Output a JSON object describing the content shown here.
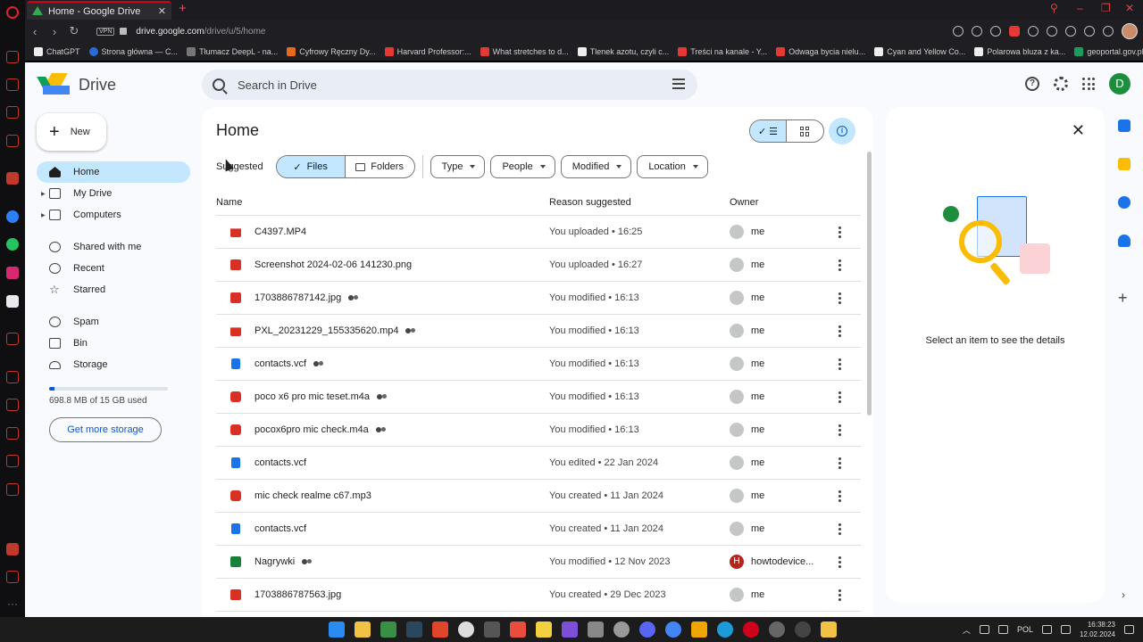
{
  "browser": {
    "tab_title": "Home - Google Drive",
    "new_tab": "+",
    "url_host": "drive.google.com",
    "url_path": "/drive/u/5/home",
    "vpn_label": "VPN",
    "bookmarks": [
      {
        "label": "ChatGPT",
        "icon": "chatgpt-icon"
      },
      {
        "label": "Strona główna — C...",
        "icon": "globe-icon"
      },
      {
        "label": "Tłumacz DeepL - na...",
        "icon": "deepl-icon"
      },
      {
        "label": "Cyfrowy Ręczny Dy...",
        "icon": "allegro-icon"
      },
      {
        "label": "Harvard Professor:...",
        "icon": "youtube-icon"
      },
      {
        "label": "What stretches to d...",
        "icon": "youtube-icon"
      },
      {
        "label": "Tlenek azotu, czyli c...",
        "icon": "site-icon"
      },
      {
        "label": "Treści na kanale - Y...",
        "icon": "youtube-icon"
      },
      {
        "label": "Odwaga bycia nielu...",
        "icon": "youtube-icon"
      },
      {
        "label": "Cyan and Yellow Co...",
        "icon": "doc-icon"
      },
      {
        "label": "Polarowa bluza z ka...",
        "icon": "site-icon"
      },
      {
        "label": "geoportal.gov.pl",
        "icon": "geoportal-icon"
      }
    ]
  },
  "drive": {
    "app_name": "Drive",
    "search_placeholder": "Search in Drive",
    "user_initial": "D",
    "new_label": "New",
    "nav": [
      {
        "label": "Home",
        "icon": "home-icon",
        "active": true
      },
      {
        "label": "My Drive",
        "icon": "my-drive-icon"
      },
      {
        "label": "Computers",
        "icon": "computer-icon"
      },
      {
        "label": "Shared with me",
        "icon": "shared-icon"
      },
      {
        "label": "Recent",
        "icon": "clock-icon"
      },
      {
        "label": "Starred",
        "icon": "star-icon"
      },
      {
        "label": "Spam",
        "icon": "spam-icon"
      },
      {
        "label": "Bin",
        "icon": "bin-icon"
      },
      {
        "label": "Storage",
        "icon": "cloud-icon"
      }
    ],
    "storage_text": "698.8 MB of 15 GB used",
    "storage_fraction": 0.047,
    "get_more_storage": "Get more storage",
    "page_title": "Home",
    "suggested_label": "Suggested",
    "files_label": "Files",
    "folders_label": "Folders",
    "filter_chips": [
      "Type",
      "People",
      "Modified",
      "Location"
    ],
    "columns": {
      "name": "Name",
      "reason": "Reason suggested",
      "owner": "Owner"
    },
    "files": [
      {
        "name": "C4397.MP4",
        "type": "video",
        "shared": false,
        "reason": "You uploaded • 16:25",
        "owner": "me",
        "owner_initial": ""
      },
      {
        "name": "Screenshot 2024-02-06 141230.png",
        "type": "image",
        "shared": false,
        "reason": "You uploaded • 16:27",
        "owner": "me",
        "owner_initial": ""
      },
      {
        "name": "1703886787142.jpg",
        "type": "image",
        "shared": true,
        "reason": "You modified • 16:13",
        "owner": "me",
        "owner_initial": ""
      },
      {
        "name": "PXL_20231229_155335620.mp4",
        "type": "video",
        "shared": true,
        "reason": "You modified • 16:13",
        "owner": "me",
        "owner_initial": ""
      },
      {
        "name": "contacts.vcf",
        "type": "doc",
        "shared": true,
        "reason": "You modified • 16:13",
        "owner": "me",
        "owner_initial": ""
      },
      {
        "name": "poco x6 pro mic teset.m4a",
        "type": "audio",
        "shared": true,
        "reason": "You modified • 16:13",
        "owner": "me",
        "owner_initial": ""
      },
      {
        "name": "pocox6pro mic check.m4a",
        "type": "audio",
        "shared": true,
        "reason": "You modified • 16:13",
        "owner": "me",
        "owner_initial": ""
      },
      {
        "name": "contacts.vcf",
        "type": "doc",
        "shared": false,
        "reason": "You edited • 22 Jan 2024",
        "owner": "me",
        "owner_initial": ""
      },
      {
        "name": "mic check realme c67.mp3",
        "type": "audio",
        "shared": false,
        "reason": "You created • 11 Jan 2024",
        "owner": "me",
        "owner_initial": ""
      },
      {
        "name": "contacts.vcf",
        "type": "doc",
        "shared": false,
        "reason": "You created • 11 Jan 2024",
        "owner": "me",
        "owner_initial": ""
      },
      {
        "name": "Nagrywki",
        "type": "sheet",
        "shared": true,
        "reason": "You modified • 12 Nov 2023",
        "owner": "howtodevice...",
        "owner_initial": "H"
      },
      {
        "name": "1703886787563.jpg",
        "type": "image",
        "shared": false,
        "reason": "You created • 29 Dec 2023",
        "owner": "me",
        "owner_initial": ""
      }
    ],
    "details_text": "Select an item to see the details"
  },
  "taskbar": {
    "language": "POL",
    "time": "16:38:23",
    "date": "12.02.2024"
  },
  "colors": {
    "accent_blue": "#0b57d0",
    "selected_bg": "#c2e7ff",
    "page_bg": "#f8fafd",
    "opera_red": "#d0021b"
  }
}
